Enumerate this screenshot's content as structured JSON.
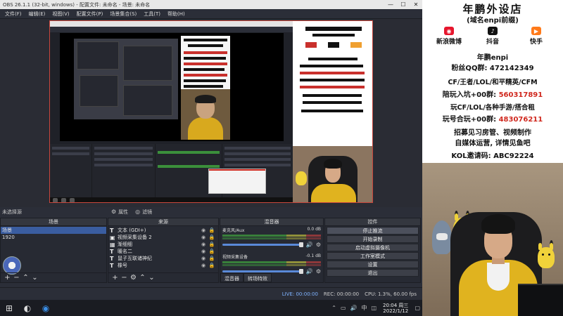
{
  "obs": {
    "title": "OBS 26.1.1 (32-bit, windows) - 配置文件: 未命名 - 场景: 未命名",
    "window_controls": [
      "—",
      "☐",
      "✕"
    ],
    "menu": [
      "文件(F)",
      "编辑(E)",
      "视图(V)",
      "配置文件(P)",
      "场景集合(S)",
      "工具(T)",
      "帮助(H)"
    ],
    "no_source": "未选择源",
    "props_label": "属性",
    "filters_label": "滤镜",
    "scenes": {
      "header": "场景",
      "items": [
        "场景",
        "1920"
      ]
    },
    "sources": {
      "header": "来源",
      "items": [
        "文本 (GDI+)",
        "视频采集设备 2",
        "渐细细",
        "暖名二",
        "鼠子互联诸神纪",
        "橡号"
      ]
    },
    "mixer": {
      "header": "混音器",
      "channels": [
        {
          "name": "麦克风/Aux",
          "db": "0.0 dB"
        },
        {
          "name": "视频采集设备",
          "db": "-0.1 dB"
        }
      ],
      "tabs": [
        "混音器",
        "转场特效"
      ]
    },
    "controls": {
      "header": "控件",
      "buttons": [
        "停止推流",
        "开始录制",
        "启动虚拟摄像机",
        "工作室模式",
        "设置",
        "退出"
      ]
    },
    "status": {
      "live": "LIVE: 00:00:00",
      "rec": "REC: 00:00:00",
      "cpu": "CPU: 1.3%, 60.00 fps"
    }
  },
  "taskbar": {
    "time": "20:04 周三",
    "date": "2022/1/12",
    "ime": "中"
  },
  "poster": {
    "title": "年鹏外设店",
    "subtitle": "(域名enpi前缀)",
    "social": [
      "新浪微博",
      "抖音",
      "快手"
    ],
    "name": "年鹏enpi",
    "qq_fans": "粉丝QQ群: 472142349",
    "line1": "CF/王者/LOL/和平精英/CFM",
    "line2_prefix": "陪玩入坑+00群:",
    "line2_num": "560317891",
    "line3": "玩CF/LOL/各种手游/搭合租",
    "line4_prefix": "玩号合玩+00群:",
    "line4_num": "483076211",
    "line5": "招募见习房管、视频制作",
    "line6": "自媒体运营, 详情见鱼吧",
    "line7": "KOL邀请码: ABC92224"
  },
  "colors": {
    "accent_red": "#d0281e",
    "obs_bg": "#2b2e38",
    "selection": "#3a5da0",
    "jacket": "#e0b31f"
  }
}
